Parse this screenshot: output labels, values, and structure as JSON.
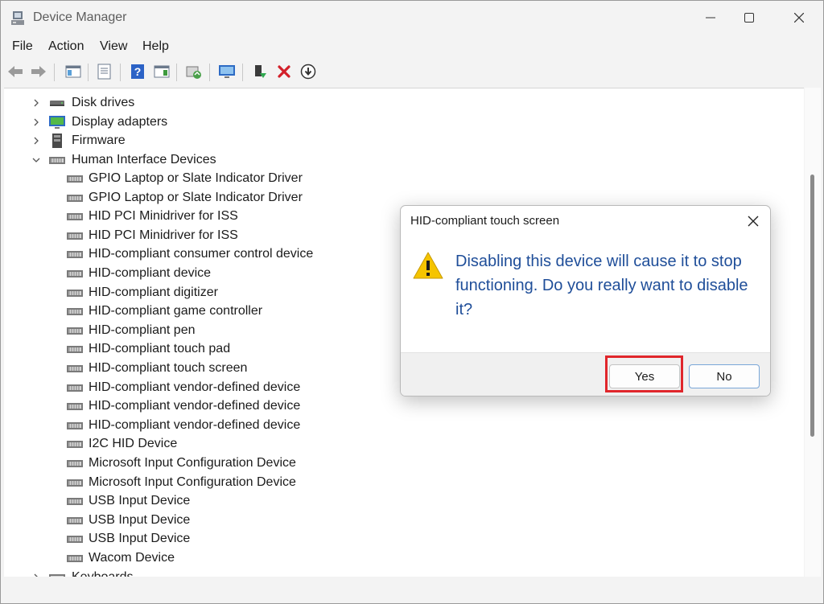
{
  "window": {
    "title": "Device Manager"
  },
  "menu": [
    "File",
    "Action",
    "View",
    "Help"
  ],
  "tree": {
    "categories_before": [
      {
        "label": "Disk drives",
        "icon": "disk-drive-icon"
      },
      {
        "label": "Display adapters",
        "icon": "display-adapter-icon"
      },
      {
        "label": "Firmware",
        "icon": "firmware-icon"
      }
    ],
    "expanded": {
      "label": "Human Interface Devices",
      "icon": "hid-icon"
    },
    "devices": [
      "GPIO Laptop or Slate Indicator Driver",
      "GPIO Laptop or Slate Indicator Driver",
      "HID PCI Minidriver for ISS",
      "HID PCI Minidriver for ISS",
      "HID-compliant consumer control device",
      "HID-compliant device",
      "HID-compliant digitizer",
      "HID-compliant game controller",
      "HID-compliant pen",
      "HID-compliant touch pad",
      "HID-compliant touch screen",
      "HID-compliant vendor-defined device",
      "HID-compliant vendor-defined device",
      "HID-compliant vendor-defined device",
      "I2C HID Device",
      "Microsoft Input Configuration Device",
      "Microsoft Input Configuration Device",
      "USB Input Device",
      "USB Input Device",
      "USB Input Device",
      "Wacom Device"
    ],
    "categories_after": [
      {
        "label": "Keyboards",
        "icon": "keyboard-icon"
      }
    ]
  },
  "dialog": {
    "title": "HID-compliant touch screen",
    "message": "Disabling this device will cause it to stop functioning. Do you really want to disable it?",
    "yes_label": "Yes",
    "no_label": "No"
  },
  "colors": {
    "message": "#1f4e99",
    "highlight": "#e0262b",
    "warning": "#f5c400"
  }
}
